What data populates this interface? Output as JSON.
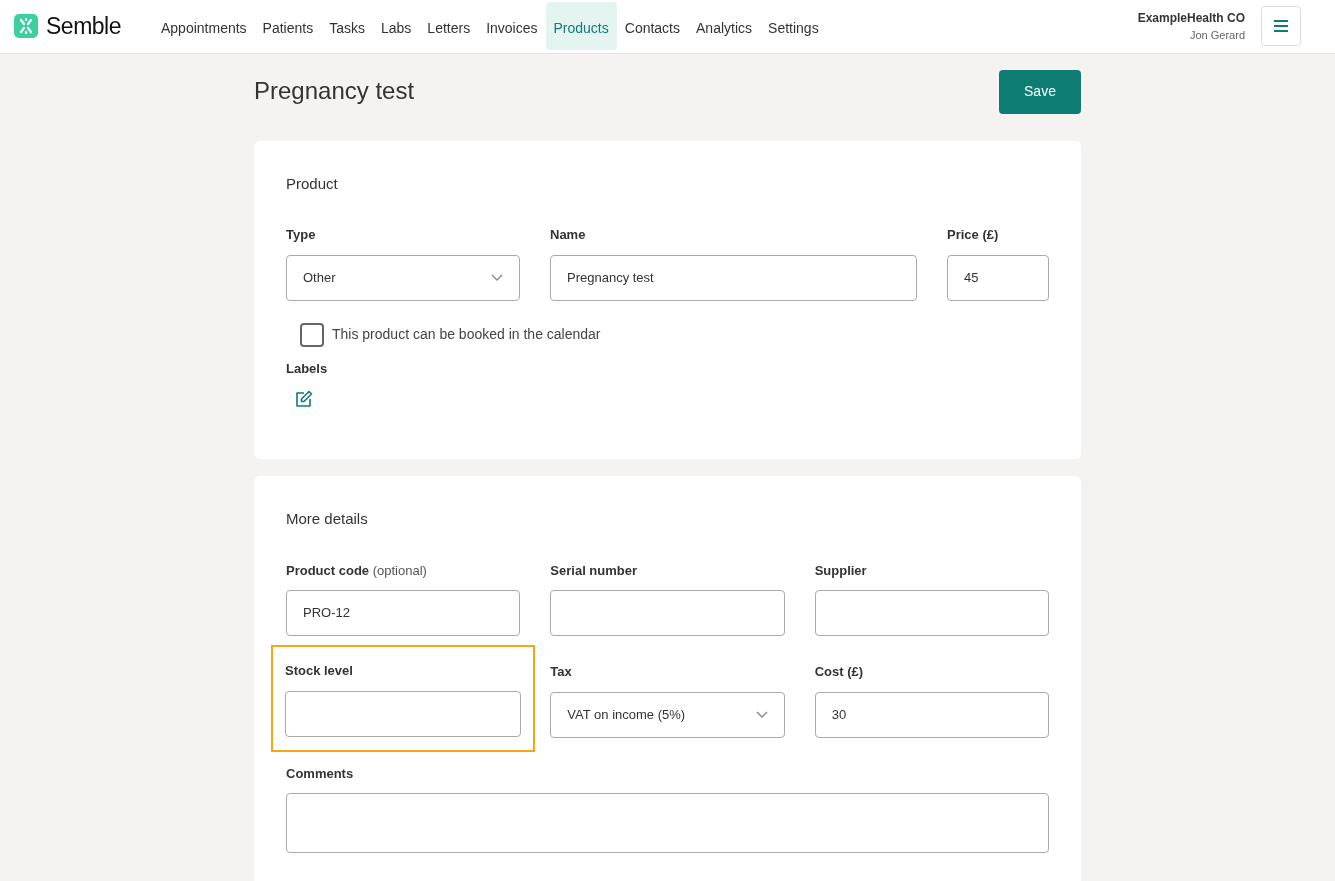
{
  "brand": "Semble",
  "nav": [
    {
      "label": "Appointments",
      "selected": false
    },
    {
      "label": "Patients",
      "selected": false
    },
    {
      "label": "Tasks",
      "selected": false
    },
    {
      "label": "Labs",
      "selected": false
    },
    {
      "label": "Letters",
      "selected": false
    },
    {
      "label": "Invoices",
      "selected": false
    },
    {
      "label": "Products",
      "selected": true
    },
    {
      "label": "Contacts",
      "selected": false
    },
    {
      "label": "Analytics",
      "selected": false
    },
    {
      "label": "Settings",
      "selected": false
    }
  ],
  "account": {
    "org": "ExampleHealth CO",
    "user": "Jon Gerard"
  },
  "page_title": "Pregnancy test",
  "save_button": "Save",
  "product_card": {
    "title": "Product",
    "fields": [
      {
        "kind": "select",
        "label": "Type",
        "value": "Other"
      },
      {
        "kind": "input",
        "label": "Name",
        "value": "Pregnancy test"
      },
      {
        "kind": "input",
        "label": "Price (£)",
        "value": "45"
      }
    ],
    "checkbox": {
      "label": "This product can be booked in the calendar",
      "checked": false
    },
    "labels_title": "Labels"
  },
  "details_card": {
    "title": "More details",
    "rows": [
      [
        {
          "kind": "input",
          "label": "Product code",
          "note": "(optional)",
          "value": "PRO-12",
          "highlighted": false
        },
        {
          "kind": "input",
          "label": "Serial number",
          "highlighted": false
        },
        {
          "kind": "input",
          "label": "Supplier",
          "highlighted": false
        }
      ],
      [
        {
          "kind": "input",
          "label": "Stock level",
          "highlighted": true
        },
        {
          "kind": "select",
          "label": "Tax",
          "value": "VAT on income (5%)",
          "highlighted": false
        },
        {
          "kind": "input",
          "label": "Cost (£)",
          "value": "30",
          "highlighted": false
        }
      ],
      [
        {
          "kind": "textarea",
          "label": "Comments",
          "highlighted": false
        }
      ]
    ]
  }
}
